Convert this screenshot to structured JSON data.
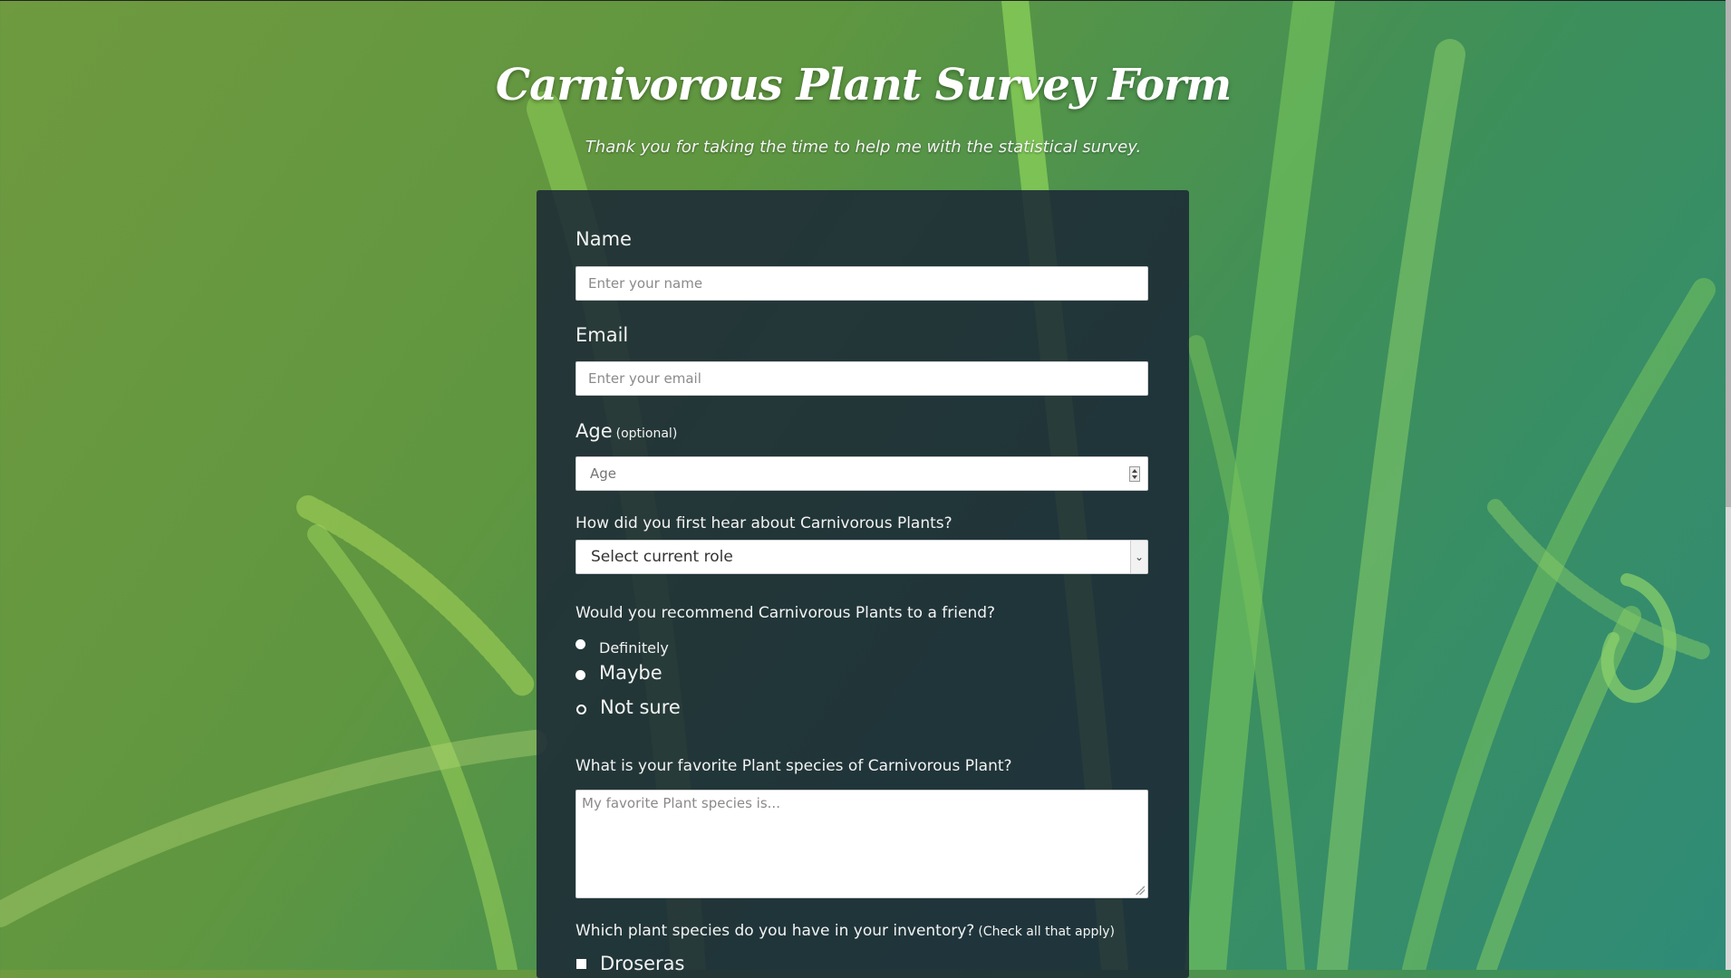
{
  "header": {
    "title": "Carnivorous Plant Survey Form",
    "description": "Thank you for taking the time to help me with the statistical survey."
  },
  "form": {
    "name": {
      "label": "Name",
      "placeholder": "Enter your name"
    },
    "email": {
      "label": "Email",
      "placeholder": "Enter your email"
    },
    "age": {
      "label": "Age",
      "note": "(optional)",
      "placeholder": "Age"
    },
    "heard": {
      "label": "How did you first hear about Carnivorous Plants?",
      "selected": "Select current role"
    },
    "recommend": {
      "label": "Would you recommend Carnivorous Plants to a friend?",
      "options": [
        "Definitely",
        "Maybe",
        "Not sure"
      ]
    },
    "favorite": {
      "label": "What is your favorite Plant species of Carnivorous Plant?",
      "placeholder": "My favorite Plant species is..."
    },
    "inventory": {
      "label": "Which plant species do you have in your inventory?",
      "note": "(Check all that apply)",
      "options": [
        "Droseras"
      ]
    }
  },
  "icons": {
    "select_arrow": "chevron-down-icon",
    "spinner": "number-spinner-icon",
    "resize": "resize-grip-icon"
  },
  "colors": {
    "card_background": "#1b2735",
    "background_green": "#5f9640",
    "background_teal": "#2f8b78"
  }
}
